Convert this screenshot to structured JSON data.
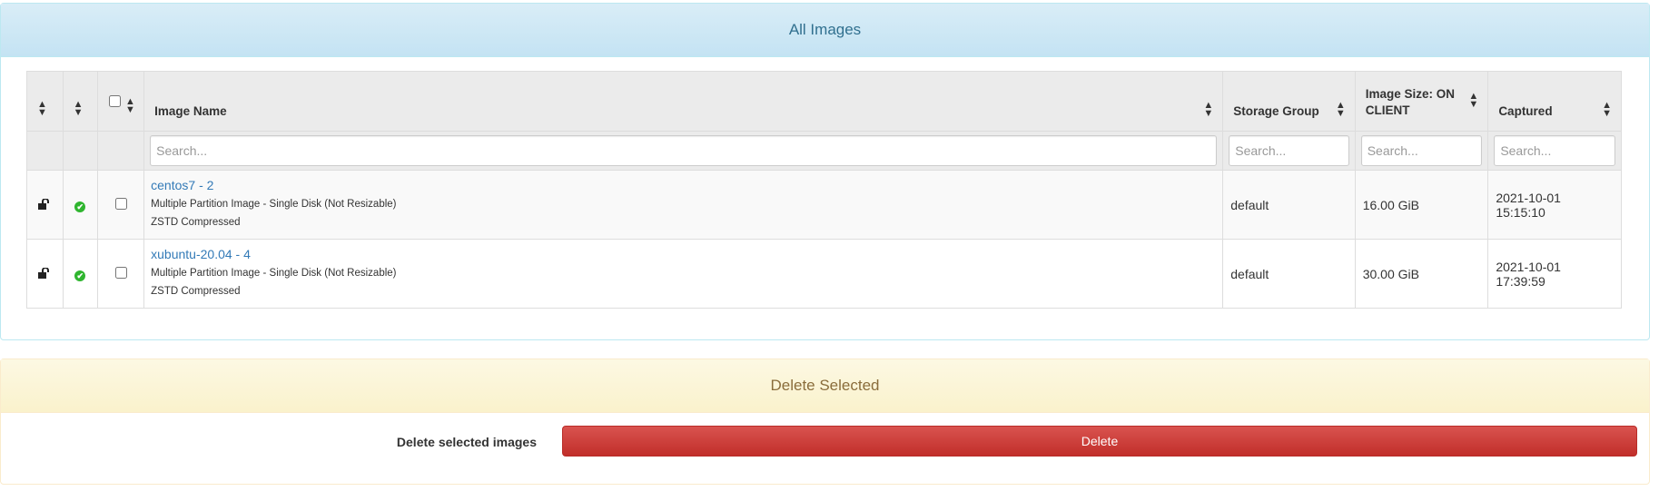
{
  "all_images": {
    "title": "All Images",
    "columns": {
      "image_name": "Image Name",
      "storage_group": "Storage Group",
      "image_size_line1": "Image Size: ON",
      "image_size_line2": "CLIENT",
      "captured": "Captured"
    },
    "search_placeholder": "Search...",
    "rows": [
      {
        "name": "centos7 - 2",
        "type": "Multiple Partition Image - Single Disk (Not Resizable)",
        "compression": "ZSTD Compressed",
        "storage_group": "default",
        "size": "16.00 GiB",
        "captured": "2021-10-01 15:15:10"
      },
      {
        "name": "xubuntu-20.04 - 4",
        "type": "Multiple Partition Image - Single Disk (Not Resizable)",
        "compression": "ZSTD Compressed",
        "storage_group": "default",
        "size": "30.00 GiB",
        "captured": "2021-10-01 17:39:59"
      }
    ]
  },
  "delete_selected": {
    "title": "Delete Selected",
    "label": "Delete selected images",
    "button_label": "Delete"
  },
  "colors": {
    "info_heading": "#d9edf7",
    "warning_heading": "#fcf8e3",
    "delete_button": "#d9534f",
    "link": "#337ab7",
    "status_ok": "#2fb52f"
  },
  "icons": [
    "unlock-icon",
    "check-circle-icon",
    "sort-icon"
  ]
}
